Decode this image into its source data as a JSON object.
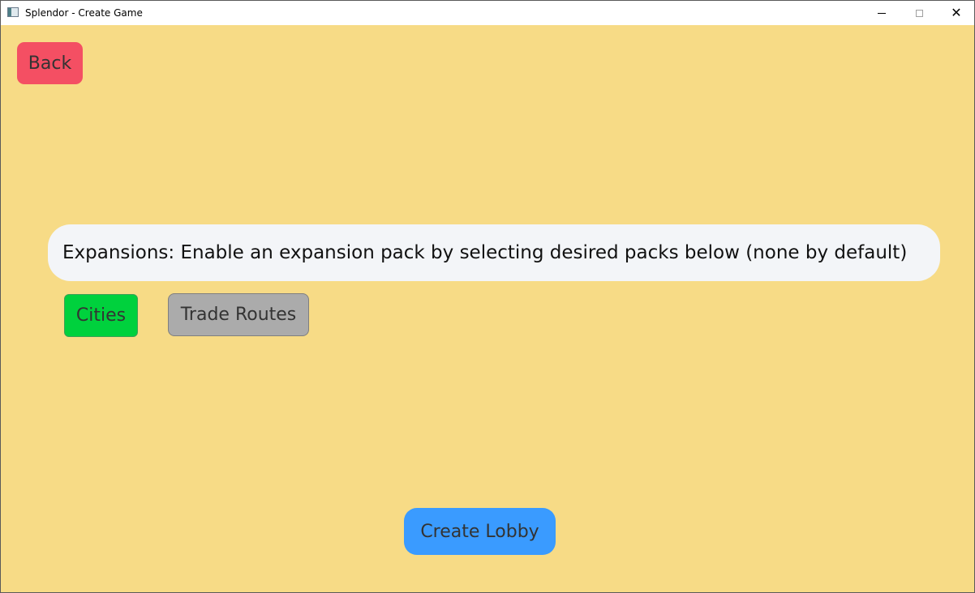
{
  "window": {
    "title": "Splendor - Create Game",
    "close_glyph": "✕"
  },
  "nav": {
    "back_label": "Back"
  },
  "expansions": {
    "info_text": "Expansions: Enable an expansion pack by selecting desired packs below (none by default)",
    "options": [
      {
        "label": "Cities",
        "selected": true,
        "color": "#00d13d"
      },
      {
        "label": "Trade Routes",
        "selected": false,
        "color": "#ababab"
      }
    ]
  },
  "actions": {
    "create_label": "Create Lobby"
  },
  "colors": {
    "background": "#f7db86",
    "back_button": "#f44f63",
    "create_button": "#3a9bff",
    "info_pill": "#f3f5f8"
  }
}
